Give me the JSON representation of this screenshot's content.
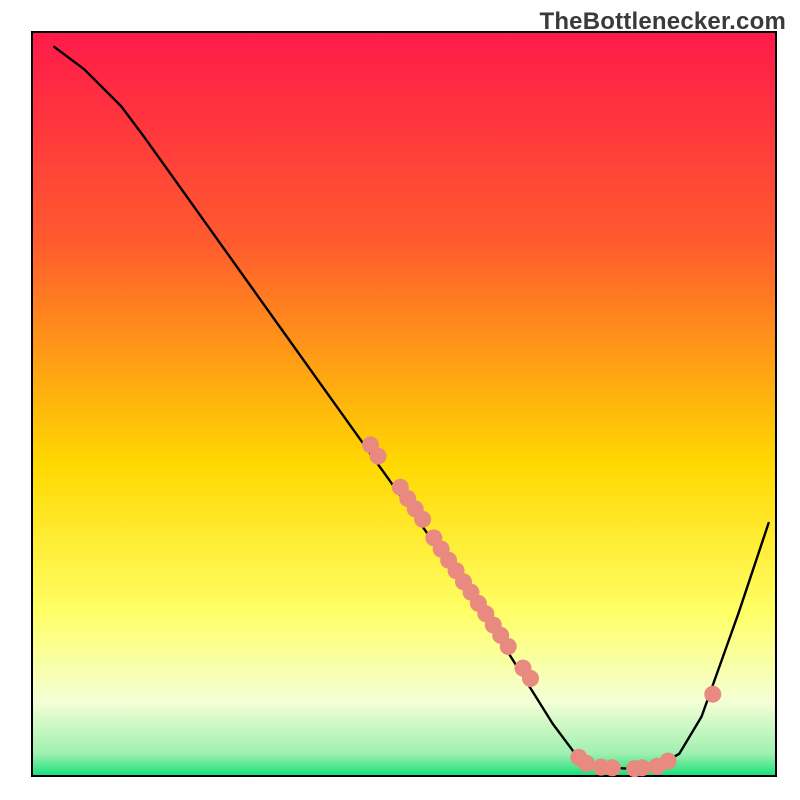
{
  "watermark": "TheBottlenecker.com",
  "colors": {
    "gradient_top": "#ff1a4a",
    "gradient_mid_upper": "#ff5a2e",
    "gradient_mid": "#ffd800",
    "gradient_low_yellow": "#ffff66",
    "gradient_pale": "#f4ffd6",
    "gradient_bottom": "#14e07a",
    "curve_stroke": "#000000",
    "marker_fill": "#e98a80",
    "axis_stroke": "#000000"
  },
  "chart_data": {
    "type": "line",
    "title": "",
    "xlabel": "",
    "ylabel": "",
    "xlim": [
      0,
      100
    ],
    "ylim": [
      0,
      100
    ],
    "series": [
      {
        "name": "curve",
        "points": [
          {
            "x": 3,
            "y": 98
          },
          {
            "x": 7,
            "y": 95
          },
          {
            "x": 12,
            "y": 90
          },
          {
            "x": 15,
            "y": 86
          },
          {
            "x": 20,
            "y": 79
          },
          {
            "x": 25,
            "y": 72
          },
          {
            "x": 30,
            "y": 65
          },
          {
            "x": 35,
            "y": 58
          },
          {
            "x": 40,
            "y": 51
          },
          {
            "x": 45,
            "y": 44
          },
          {
            "x": 50,
            "y": 37
          },
          {
            "x": 55,
            "y": 30
          },
          {
            "x": 60,
            "y": 23
          },
          {
            "x": 65,
            "y": 15
          },
          {
            "x": 70,
            "y": 7
          },
          {
            "x": 73,
            "y": 3
          },
          {
            "x": 76,
            "y": 1.2
          },
          {
            "x": 80,
            "y": 1.0
          },
          {
            "x": 84,
            "y": 1.2
          },
          {
            "x": 87,
            "y": 3
          },
          {
            "x": 90,
            "y": 8
          },
          {
            "x": 95,
            "y": 22
          },
          {
            "x": 99,
            "y": 34
          }
        ]
      }
    ],
    "markers": [
      {
        "x": 45.5,
        "y": 44.5
      },
      {
        "x": 46.5,
        "y": 43.0
      },
      {
        "x": 49.5,
        "y": 38.8
      },
      {
        "x": 50.5,
        "y": 37.3
      },
      {
        "x": 51.5,
        "y": 35.9
      },
      {
        "x": 52.5,
        "y": 34.5
      },
      {
        "x": 54.0,
        "y": 32.0
      },
      {
        "x": 55.0,
        "y": 30.5
      },
      {
        "x": 56.0,
        "y": 29.0
      },
      {
        "x": 57.0,
        "y": 27.6
      },
      {
        "x": 58.0,
        "y": 26.1
      },
      {
        "x": 59.0,
        "y": 24.7
      },
      {
        "x": 60.0,
        "y": 23.2
      },
      {
        "x": 61.0,
        "y": 21.8
      },
      {
        "x": 62.0,
        "y": 20.3
      },
      {
        "x": 63.0,
        "y": 18.9
      },
      {
        "x": 64.0,
        "y": 17.4
      },
      {
        "x": 66.0,
        "y": 14.5
      },
      {
        "x": 67.0,
        "y": 13.1
      },
      {
        "x": 73.5,
        "y": 2.5
      },
      {
        "x": 74.5,
        "y": 1.7
      },
      {
        "x": 76.5,
        "y": 1.2
      },
      {
        "x": 78.0,
        "y": 1.1
      },
      {
        "x": 81.0,
        "y": 1.0
      },
      {
        "x": 82.0,
        "y": 1.1
      },
      {
        "x": 84.0,
        "y": 1.3
      },
      {
        "x": 85.5,
        "y": 2.0
      },
      {
        "x": 91.5,
        "y": 11.0
      }
    ]
  }
}
